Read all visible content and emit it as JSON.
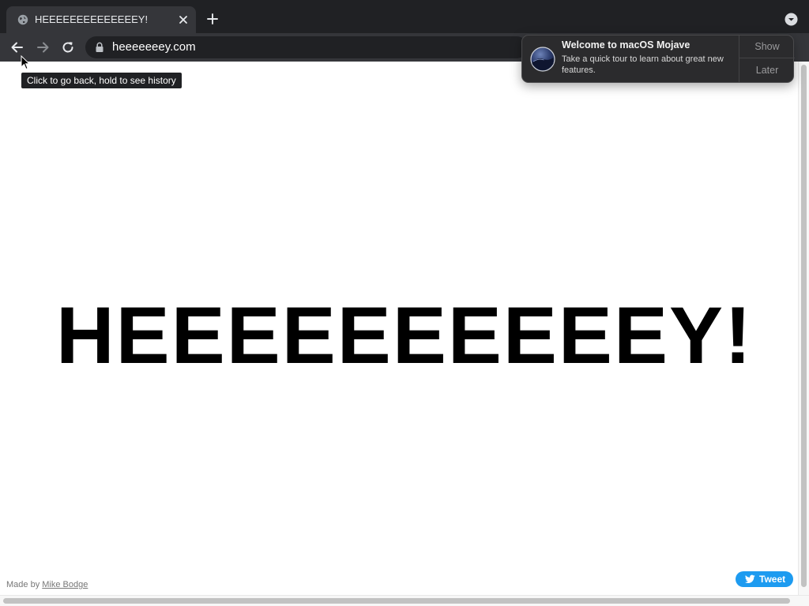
{
  "tab": {
    "title": "HEEEEEEEEEEEEEEY!",
    "favicon": "globe-icon"
  },
  "toolbar": {
    "url": "heeeeeeey.com"
  },
  "tooltip": {
    "text": "Click to go back, hold to see history"
  },
  "page": {
    "headline": "HEEEEEEEEEEY!",
    "credit_prefix": "Made by",
    "credit_author": "Mike Bodge",
    "tweet_label": "Tweet"
  },
  "notification": {
    "title": "Welcome to macOS Mojave",
    "body": "Take a quick tour to learn about great new features.",
    "show_label": "Show",
    "later_label": "Later"
  },
  "colors": {
    "tabbar": "#202124",
    "toolbar": "#35363a",
    "tweet": "#1d9bf0",
    "notification_bg": "#2b2b2d"
  }
}
